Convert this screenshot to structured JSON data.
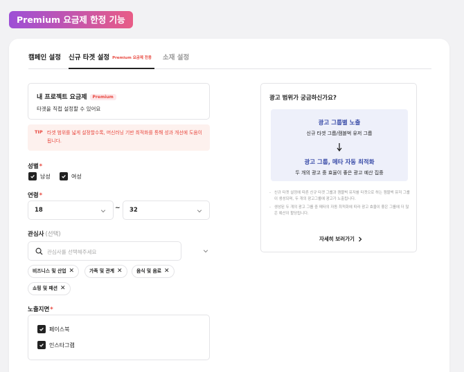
{
  "banner": {
    "label": "Premium 요금제 한정 기능"
  },
  "tabs": [
    {
      "label": "캠페인 설정"
    },
    {
      "label": "신규 타겟 설정",
      "badge": "Premium 요금제 전용"
    },
    {
      "label": "소재 설정"
    }
  ],
  "plan": {
    "title": "내 프로젝트 요금제",
    "badge": "Premium",
    "description": "타겟을 직접 설정할 수 있어요"
  },
  "tip": {
    "label": "TIP",
    "text": "타겟 범위를 넓게 설정할수록, 머신러닝 기반 최적화를 통해 성과 개선에 도움이 됩니다."
  },
  "gender": {
    "label": "성별",
    "required": "*",
    "options": [
      {
        "label": "남성",
        "checked": true
      },
      {
        "label": "여성",
        "checked": true
      }
    ]
  },
  "age": {
    "label": "연령",
    "required": "*",
    "min": "18",
    "separator": "~",
    "max": "32"
  },
  "interests": {
    "label": "관심사",
    "sub_label": "(선택)",
    "placeholder": "관심사를 선택해주세요",
    "chips": [
      "비즈니스 및 산업",
      "가족 및 관계",
      "음식 및 음료",
      "쇼핑 및 패션"
    ]
  },
  "placements": {
    "label": "노출지면",
    "required": "*",
    "options": [
      {
        "label": "페이스북",
        "checked": true
      },
      {
        "label": "인스타그램",
        "checked": true
      }
    ]
  },
  "info": {
    "title": "광고 범위가 궁금하신가요?",
    "step1_title": "광고 그룹별 노출",
    "step1_desc": "신규 타겟 그룹/캠블벅 유저 그룹",
    "step2_title": "광고 그룹, 메타 자동 최적화",
    "step2_desc": "두 개의 광고 중 효율이 좋은 광고 예산 집중",
    "notes": [
      "신규 타겟 설정에 따른 신규 타겟 그룹과 캠블벅 유저를 타겟으로 하는 캠블벅 유저 그룹이 생성되며, 두 개의 광고그룹에 광고가 노출됩니다.",
      "생성된 두 개의 광고 그룹 중 메타의 자동 최적화에 따라 광고 효율이 좋은 그룹에 더 많은 예산이 할당됩니다."
    ],
    "more_label": "자세히 보러가기"
  },
  "colors": {
    "accent": "#e8473e",
    "banner_start": "#9d4fd6",
    "banner_end": "#e85c86",
    "diagram_bg": "#eef0fa",
    "diagram_text": "#3a4ca8"
  }
}
